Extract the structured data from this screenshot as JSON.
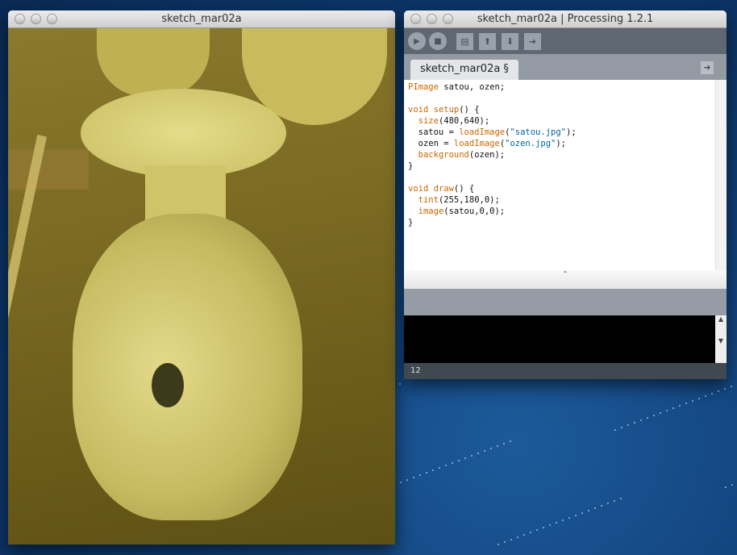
{
  "sketch_window": {
    "title": "sketch_mar02a"
  },
  "ide_window": {
    "title": "sketch_mar02a | Processing 1.2.1",
    "toolbar": {
      "run": "run-icon",
      "stop": "stop-icon",
      "new": "new-icon",
      "open": "open-icon",
      "save": "save-icon",
      "export": "export-icon"
    },
    "tab_label": "sketch_mar02a §",
    "code_lines": [
      [
        {
          "t": "PImage",
          "k": "kw"
        },
        {
          "t": " satou, ozen;"
        }
      ],
      [],
      [
        {
          "t": "void",
          "k": "kw"
        },
        {
          "t": " "
        },
        {
          "t": "setup",
          "k": "kw"
        },
        {
          "t": "() {"
        }
      ],
      [
        {
          "t": "  "
        },
        {
          "t": "size",
          "k": "kw"
        },
        {
          "t": "(480,640);"
        }
      ],
      [
        {
          "t": "  satou = "
        },
        {
          "t": "loadImage",
          "k": "kw"
        },
        {
          "t": "("
        },
        {
          "t": "\"satou.jpg\"",
          "k": "str"
        },
        {
          "t": ");"
        }
      ],
      [
        {
          "t": "  ozen = "
        },
        {
          "t": "loadImage",
          "k": "kw"
        },
        {
          "t": "("
        },
        {
          "t": "\"ozen.jpg\"",
          "k": "str"
        },
        {
          "t": ");"
        }
      ],
      [
        {
          "t": "  "
        },
        {
          "t": "background",
          "k": "kw"
        },
        {
          "t": "(ozen);"
        }
      ],
      [
        {
          "t": "}"
        }
      ],
      [],
      [
        {
          "t": "void",
          "k": "kw"
        },
        {
          "t": " "
        },
        {
          "t": "draw",
          "k": "kw"
        },
        {
          "t": "() {"
        }
      ],
      [
        {
          "t": "  "
        },
        {
          "t": "tint",
          "k": "kw"
        },
        {
          "t": "(255,180,0);"
        }
      ],
      [
        {
          "t": "  "
        },
        {
          "t": "image",
          "k": "kw"
        },
        {
          "t": "(satou,0,0);"
        }
      ],
      [
        {
          "t": "}"
        }
      ]
    ],
    "line_number": "12"
  },
  "colors": {
    "keyword": "#cc6600",
    "string": "#006699"
  }
}
